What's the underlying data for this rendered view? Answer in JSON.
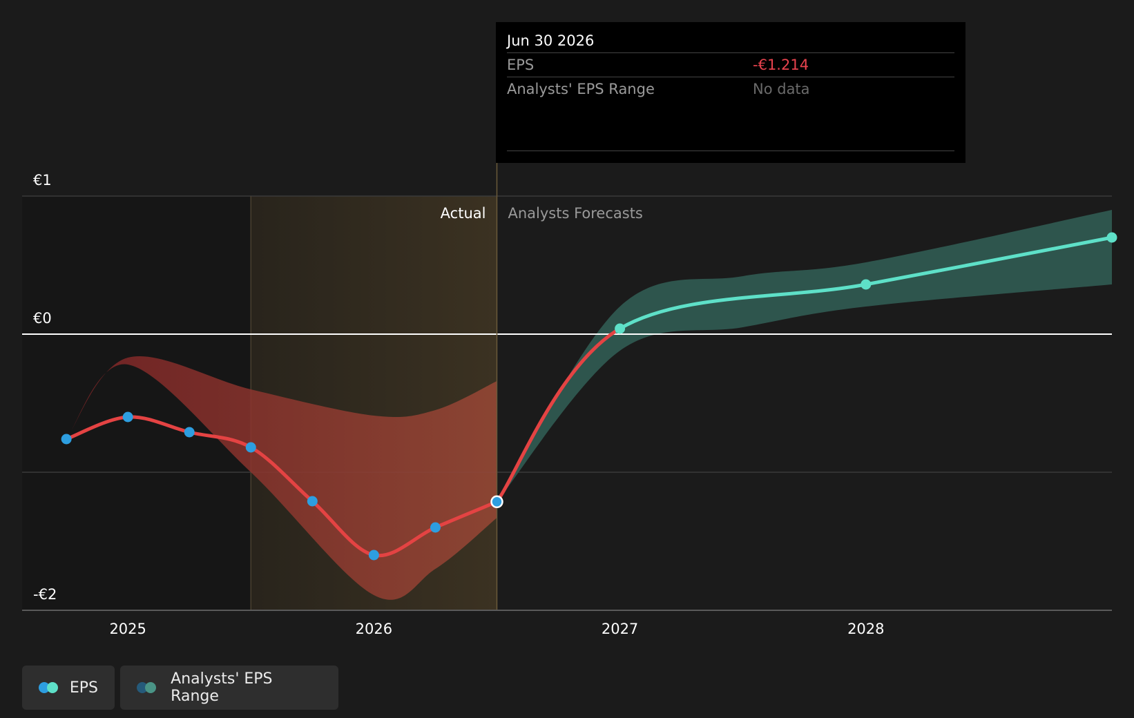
{
  "colors": {
    "background": "#1b1b1b",
    "eps_actual": "#e44343",
    "eps_forecast": "#5ee0c8",
    "eps_point": "#2d9ee0",
    "range_actual": "#8e3a30",
    "range_forecast": "#2f5850",
    "actual_shade": "#3a3020",
    "zero_line": "#ffffff",
    "grid": "#3a3a3a",
    "tooltip_eps_value": "#e8434e",
    "tooltip_muted": "#6a6a6a"
  },
  "tooltip": {
    "date": "Jun 30 2026",
    "eps_label": "EPS",
    "eps_value": "-€1.214",
    "range_label": "Analysts' EPS Range",
    "range_value": "No data"
  },
  "legend": {
    "eps_label": "EPS",
    "eps_icon": "two-dot-icon",
    "range_label": "Analysts' EPS Range",
    "range_icon": "two-dot-icon"
  },
  "chart_data": {
    "type": "line",
    "y_ticks": [
      {
        "value": 1,
        "label": "€1"
      },
      {
        "value": 0,
        "label": "€0"
      },
      {
        "value": -2,
        "label": "-€2"
      }
    ],
    "x_ticks": [
      {
        "value": 2025.0,
        "label": "2025"
      },
      {
        "value": 2026.0,
        "label": "2026"
      },
      {
        "value": 2027.0,
        "label": "2027"
      },
      {
        "value": 2028.0,
        "label": "2028"
      }
    ],
    "xlim": [
      2024.57,
      2029.0
    ],
    "ylim": [
      -2,
      1
    ],
    "section_labels": {
      "actual": "Actual",
      "forecast": "Analysts Forecasts"
    },
    "actual_shade_range": [
      2025.5,
      2026.5
    ],
    "divider_x": 2026.5,
    "series": [
      {
        "name": "EPS",
        "points": [
          {
            "x": 2024.75,
            "y": -0.76
          },
          {
            "x": 2025.0,
            "y": -0.6
          },
          {
            "x": 2025.25,
            "y": -0.71
          },
          {
            "x": 2025.5,
            "y": -0.82
          },
          {
            "x": 2025.75,
            "y": -1.21
          },
          {
            "x": 2026.0,
            "y": -1.6
          },
          {
            "x": 2026.25,
            "y": -1.4
          },
          {
            "x": 2026.5,
            "y": -1.214
          }
        ]
      },
      {
        "name": "EPS",
        "points": [
          {
            "x": 2026.5,
            "y": -1.214
          },
          {
            "x": 2027.0,
            "y": 0.04
          },
          {
            "x": 2028.0,
            "y": 0.36
          },
          {
            "x": 2029.0,
            "y": 0.7
          }
        ]
      }
    ],
    "range_bands": [
      {
        "name": "Analysts' EPS Range",
        "x": [
          2024.75,
          2025.0,
          2025.5,
          2026.0,
          2026.25,
          2026.5
        ],
        "high": [
          -0.76,
          -0.17,
          -0.4,
          -0.59,
          -0.55,
          -0.34
        ],
        "low": [
          -0.76,
          -0.22,
          -1.0,
          -1.89,
          -1.7,
          -1.33
        ]
      },
      {
        "name": "Analysts' EPS Range",
        "x": [
          2026.5,
          2027.0,
          2027.5,
          2028.0,
          2029.0
        ],
        "high": [
          -1.214,
          0.2,
          0.42,
          0.52,
          0.9
        ],
        "low": [
          -1.214,
          -0.12,
          0.05,
          0.2,
          0.36
        ]
      }
    ],
    "highlight": {
      "x": 2026.5,
      "y": -1.214
    }
  }
}
